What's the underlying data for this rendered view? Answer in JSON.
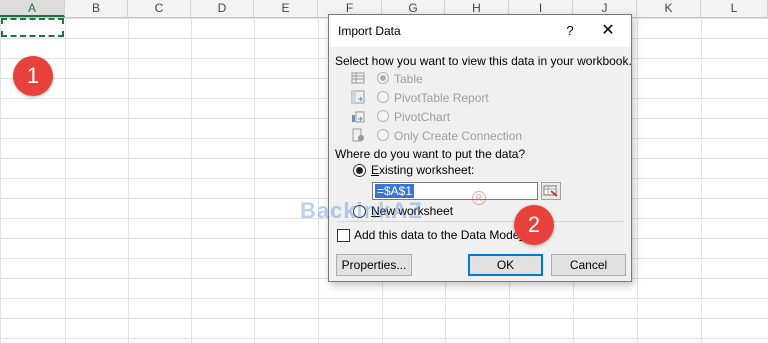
{
  "sheet": {
    "columns": [
      "A",
      "B",
      "C",
      "D",
      "E",
      "F",
      "G",
      "H",
      "I",
      "J",
      "K",
      "L"
    ],
    "active_column": "A"
  },
  "badges": {
    "step1": "1",
    "step2": "2"
  },
  "dialog": {
    "title": "Import Data",
    "help": "?",
    "close": "✕",
    "view_prompt": "Select how you want to view this data in your workbook.",
    "view_options": [
      {
        "label": "Table",
        "selected": true,
        "icon": "table-icon"
      },
      {
        "label": "PivotTable Report",
        "selected": false,
        "icon": "pivottable-icon"
      },
      {
        "label": "PivotChart",
        "selected": false,
        "icon": "pivotchart-icon"
      },
      {
        "label": "Only Create Connection",
        "selected": false,
        "icon": "connection-icon"
      }
    ],
    "where_prompt": "Where do you want to put the data?",
    "existing_worksheet": "Existing worksheet:",
    "existing_first": "E",
    "existing_rest": "xisting worksheet:",
    "reference_value": "=$A$1",
    "new_worksheet_first": "N",
    "new_worksheet_rest": "ew worksheet",
    "data_model_label": "Add this data to the Data Model",
    "data_model_first": "Add this data to the Data Mode",
    "data_model_rest": "l",
    "properties_label": "Properties...",
    "ok_label": "OK",
    "cancel_label": "Cancel"
  },
  "watermark": {
    "text": "BackinkAZ",
    "mark": "R"
  },
  "colors": {
    "excel_green": "#217346",
    "badge_red": "#e8413c",
    "ok_border": "#0078d7"
  }
}
